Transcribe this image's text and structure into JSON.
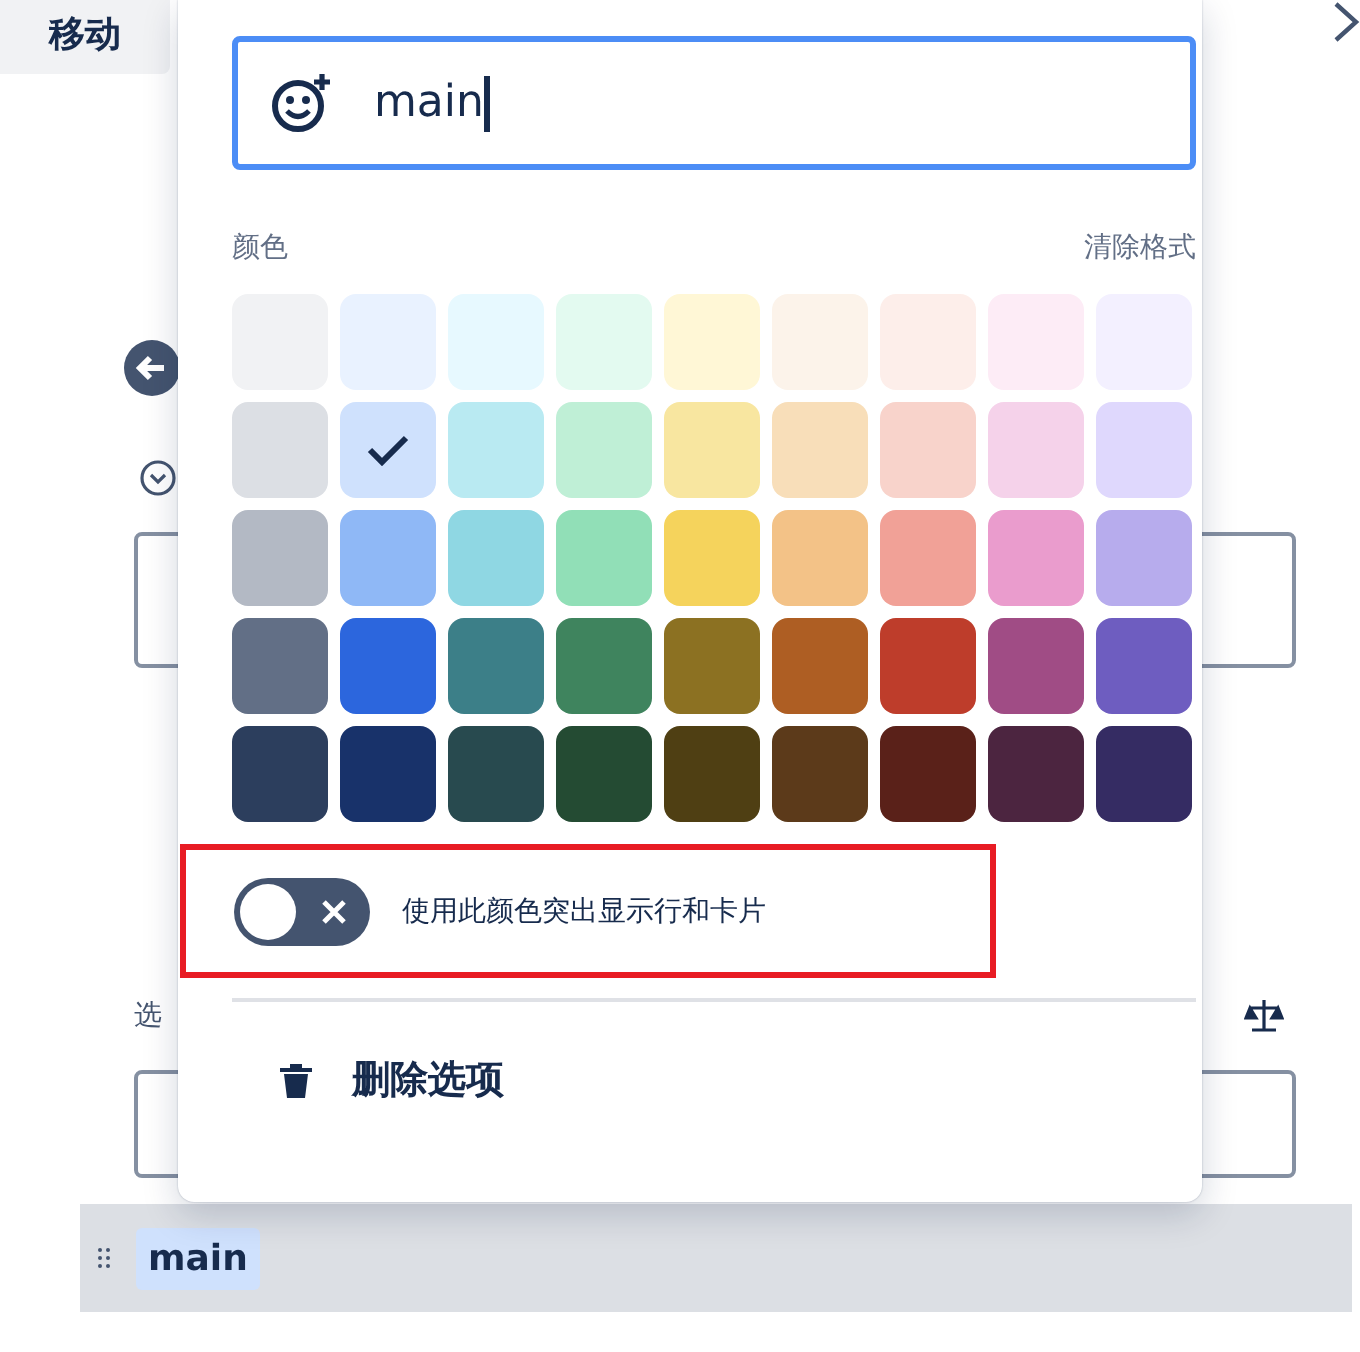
{
  "background": {
    "move_button": "移动",
    "options_label": "选",
    "tag": "main"
  },
  "popover": {
    "name_field": {
      "value": "main"
    },
    "color_label": "颜色",
    "clear_label": "清除格式",
    "swatches": [
      {
        "color": "#f1f2f4",
        "selected": false
      },
      {
        "color": "#e9f2ff",
        "selected": false
      },
      {
        "color": "#e7f9ff",
        "selected": false
      },
      {
        "color": "#e3faf0",
        "selected": false
      },
      {
        "color": "#fff7d6",
        "selected": false
      },
      {
        "color": "#fcf3ea",
        "selected": false
      },
      {
        "color": "#fdeeea",
        "selected": false
      },
      {
        "color": "#fdecf6",
        "selected": false
      },
      {
        "color": "#f3f0ff",
        "selected": false
      },
      {
        "color": "#dcdfe4",
        "selected": false
      },
      {
        "color": "#cfe1fd",
        "selected": true
      },
      {
        "color": "#b9eaf2",
        "selected": false
      },
      {
        "color": "#bfefd6",
        "selected": false
      },
      {
        "color": "#f8e6a0",
        "selected": false
      },
      {
        "color": "#f8deb9",
        "selected": false
      },
      {
        "color": "#f8d3cb",
        "selected": false
      },
      {
        "color": "#f5d2ea",
        "selected": false
      },
      {
        "color": "#dfd8fd",
        "selected": false
      },
      {
        "color": "#b3b9c4",
        "selected": false
      },
      {
        "color": "#8fb8f6",
        "selected": false
      },
      {
        "color": "#8fd7e3",
        "selected": false
      },
      {
        "color": "#91dfb7",
        "selected": false
      },
      {
        "color": "#f5d35c",
        "selected": false
      },
      {
        "color": "#f3c287",
        "selected": false
      },
      {
        "color": "#f1a197",
        "selected": false
      },
      {
        "color": "#ea9ccd",
        "selected": false
      },
      {
        "color": "#b7aced",
        "selected": false
      },
      {
        "color": "#626f86",
        "selected": false
      },
      {
        "color": "#2c66dd",
        "selected": false
      },
      {
        "color": "#3c7f88",
        "selected": false
      },
      {
        "color": "#3f845e",
        "selected": false
      },
      {
        "color": "#8c7122",
        "selected": false
      },
      {
        "color": "#ae5e23",
        "selected": false
      },
      {
        "color": "#be3d2b",
        "selected": false
      },
      {
        "color": "#a04c85",
        "selected": false
      },
      {
        "color": "#6e5dc0",
        "selected": false
      },
      {
        "color": "#2c3e5d",
        "selected": false
      },
      {
        "color": "#18326a",
        "selected": false
      },
      {
        "color": "#284a4f",
        "selected": false
      },
      {
        "color": "#244b33",
        "selected": false
      },
      {
        "color": "#4f3f13",
        "selected": false
      },
      {
        "color": "#5c3a1a",
        "selected": false
      },
      {
        "color": "#5a2119",
        "selected": false
      },
      {
        "color": "#4c2540",
        "selected": false
      },
      {
        "color": "#352c63",
        "selected": false
      }
    ],
    "highlight_toggle": {
      "on": false,
      "label": "使用此颜色突出显示行和卡片"
    },
    "delete_label": "删除选项"
  }
}
